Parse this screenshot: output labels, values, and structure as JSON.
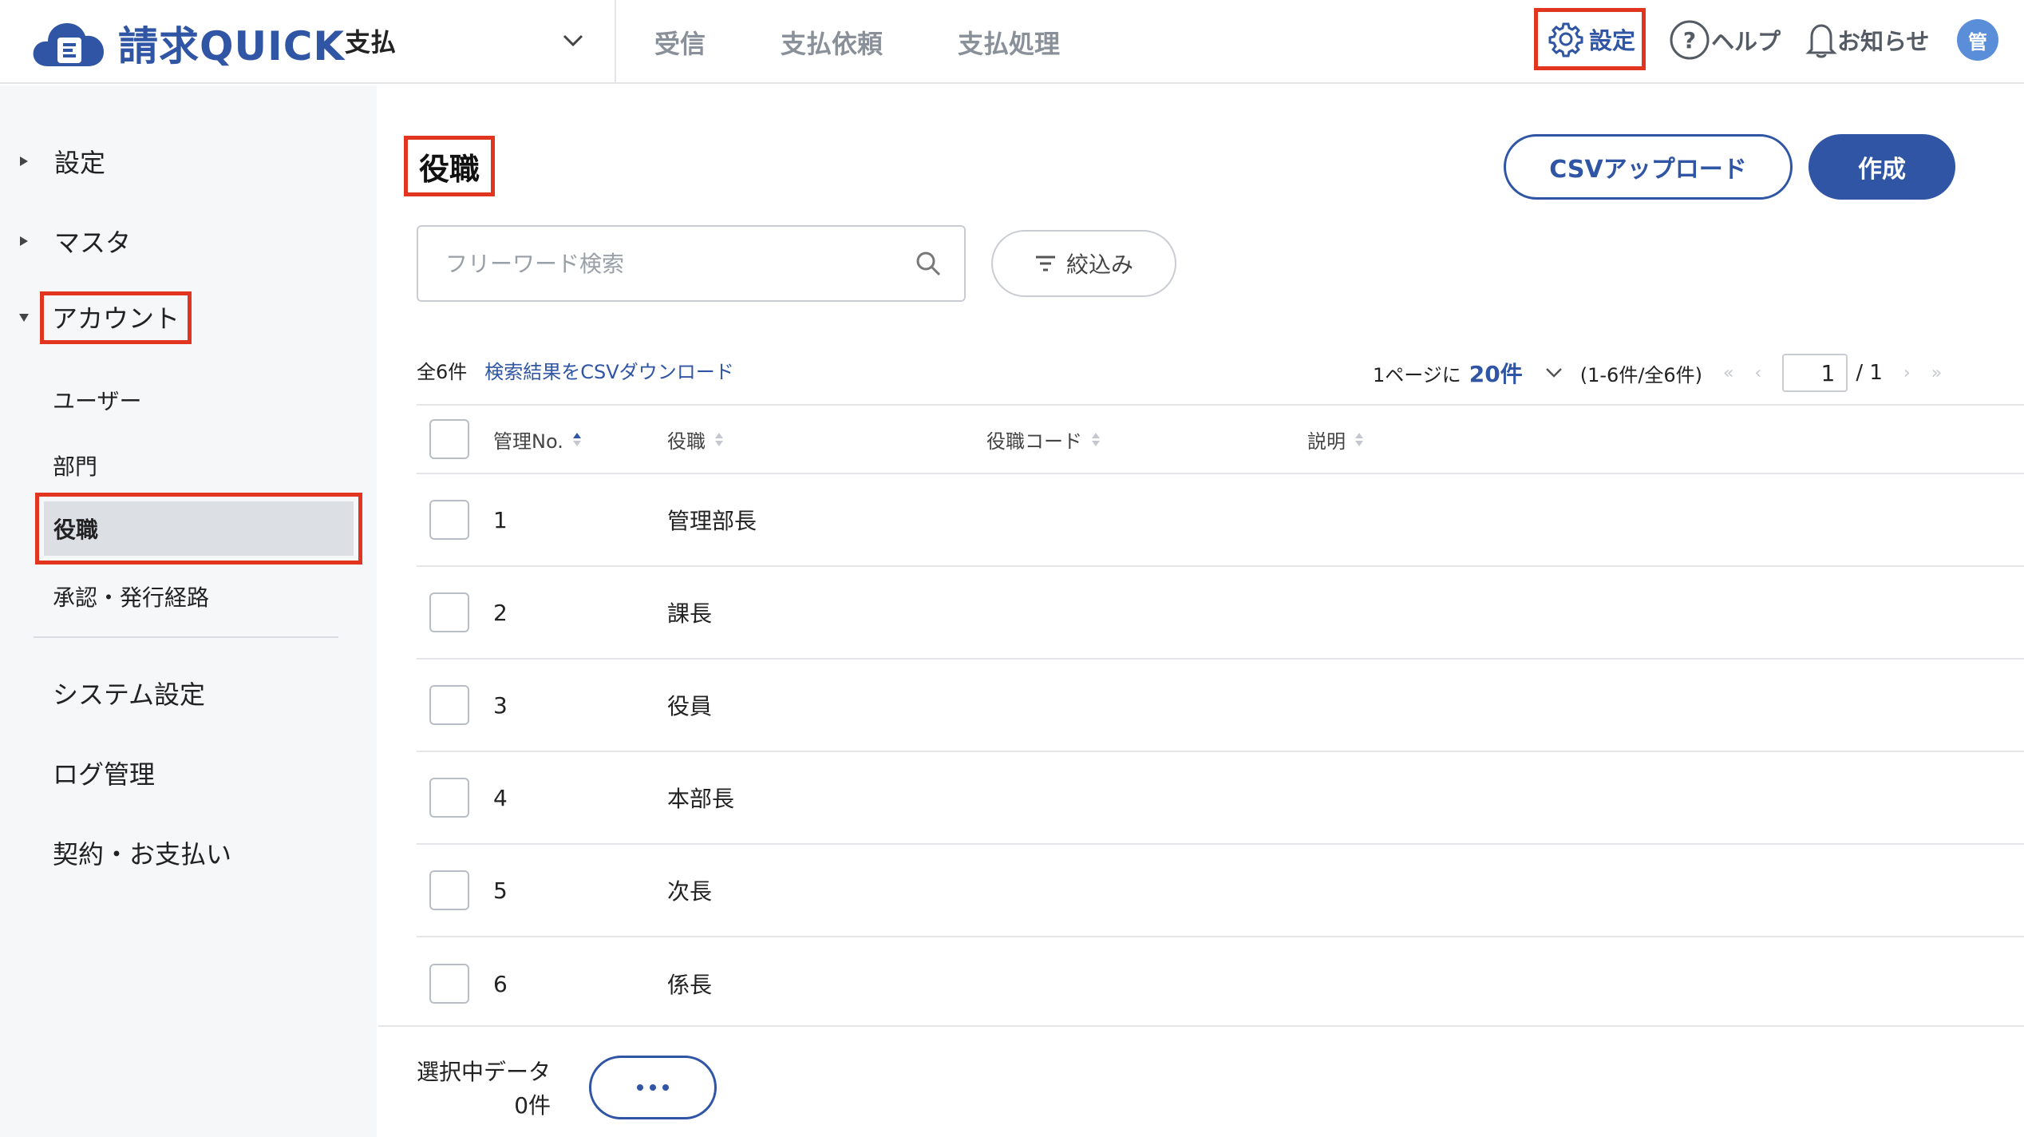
{
  "header": {
    "logo_text": "請求QUICK",
    "app_select": "支払",
    "nav": [
      "受信",
      "支払依頼",
      "支払処理"
    ],
    "settings_label": "設定",
    "help_label": "ヘルプ",
    "notice_label": "お知らせ",
    "avatar_text": "管"
  },
  "sidebar": {
    "groups": [
      {
        "label": "設定",
        "expanded": false
      },
      {
        "label": "マスタ",
        "expanded": false
      },
      {
        "label": "アカウント",
        "expanded": true
      }
    ],
    "account_items": [
      "ユーザー",
      "部門",
      "役職",
      "承認・発行経路"
    ],
    "active_item": "役職",
    "main_items": [
      "システム設定",
      "ログ管理",
      "契約・お支払い"
    ]
  },
  "main": {
    "title": "役職",
    "csv_upload_label": "CSVアップロード",
    "create_label": "作成",
    "search_placeholder": "フリーワード検索",
    "filter_label": "絞込み",
    "total_count": "全6件",
    "csv_download_label": "検索結果をCSVダウンロード",
    "per_page_prefix": "1ページに",
    "per_page_value": "20件",
    "range_text": "(1-6件/全6件)",
    "current_page": "1",
    "total_pages": "/ 1",
    "columns": [
      "管理No.",
      "役職",
      "役職コード",
      "説明"
    ],
    "rows": [
      {
        "no": "1",
        "name": "管理部長",
        "code": "",
        "desc": ""
      },
      {
        "no": "2",
        "name": "課長",
        "code": "",
        "desc": ""
      },
      {
        "no": "3",
        "name": "役員",
        "code": "",
        "desc": ""
      },
      {
        "no": "4",
        "name": "本部長",
        "code": "",
        "desc": ""
      },
      {
        "no": "5",
        "name": "次長",
        "code": "",
        "desc": ""
      },
      {
        "no": "6",
        "name": "係長",
        "code": "",
        "desc": ""
      }
    ],
    "selected_label": "選択中データ",
    "selected_count": "0件"
  },
  "colors": {
    "brand": "#2f55a4",
    "highlight": "#e1351f",
    "sidebar_bg": "#f6f7f9"
  }
}
